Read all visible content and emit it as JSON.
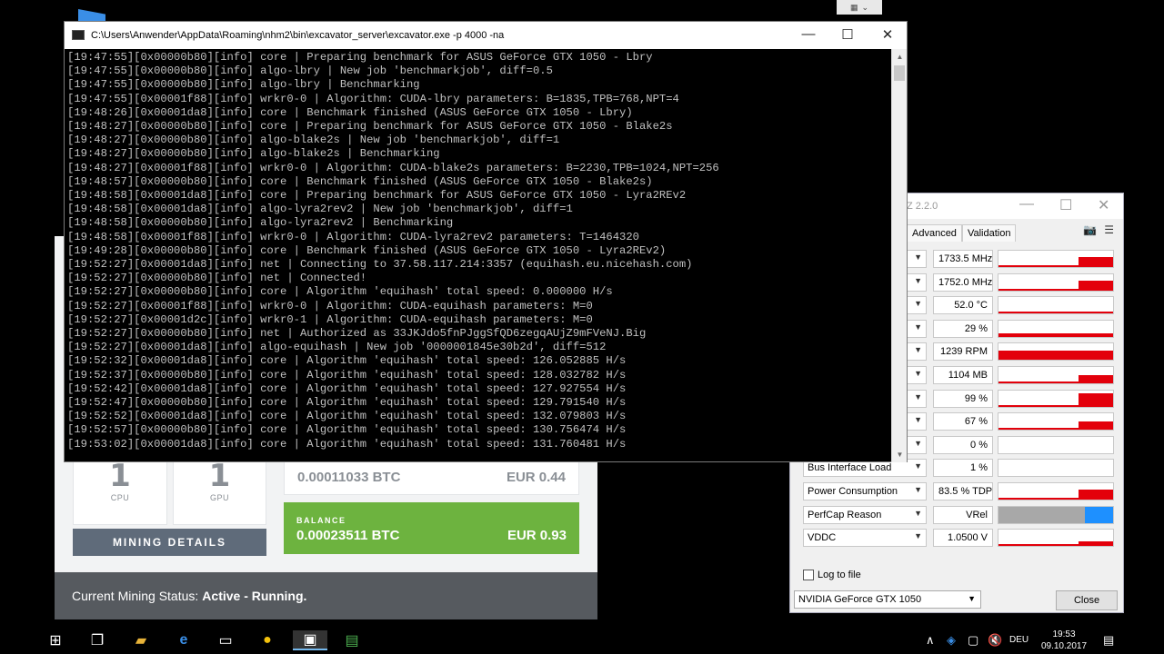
{
  "console": {
    "title": "C:\\Users\\Anwender\\AppData\\Roaming\\nhm2\\bin\\excavator_server\\excavator.exe  -p 4000 -na",
    "lines": [
      "[19:47:55][0x00000b80][info] core | Preparing benchmark for ASUS GeForce GTX 1050 - Lbry",
      "[19:47:55][0x00000b80][info] algo-lbry | New job 'benchmarkjob', diff=0.5",
      "[19:47:55][0x00000b80][info] algo-lbry | Benchmarking",
      "[19:47:55][0x00001f88][info] wrkr0-0 | Algorithm: CUDA-lbry parameters: B=1835,TPB=768,NPT=4",
      "[19:48:26][0x00001da8][info] core | Benchmark finished (ASUS GeForce GTX 1050 - Lbry)",
      "[19:48:27][0x00000b80][info] core | Preparing benchmark for ASUS GeForce GTX 1050 - Blake2s",
      "[19:48:27][0x00000b80][info] algo-blake2s | New job 'benchmarkjob', diff=1",
      "[19:48:27][0x00000b80][info] algo-blake2s | Benchmarking",
      "[19:48:27][0x00001f88][info] wrkr0-0 | Algorithm: CUDA-blake2s parameters: B=2230,TPB=1024,NPT=256",
      "[19:48:57][0x00000b80][info] core | Benchmark finished (ASUS GeForce GTX 1050 - Blake2s)",
      "[19:48:58][0x00001da8][info] core | Preparing benchmark for ASUS GeForce GTX 1050 - Lyra2REv2",
      "[19:48:58][0x00001da8][info] algo-lyra2rev2 | New job 'benchmarkjob', diff=1",
      "[19:48:58][0x00000b80][info] algo-lyra2rev2 | Benchmarking",
      "[19:48:58][0x00001f88][info] wrkr0-0 | Algorithm: CUDA-lyra2rev2 parameters: T=1464320",
      "[19:49:28][0x00000b80][info] core | Benchmark finished (ASUS GeForce GTX 1050 - Lyra2REv2)",
      "[19:52:27][0x00001da8][info] net | Connecting to 37.58.117.214:3357 (equihash.eu.nicehash.com)",
      "[19:52:27][0x00000b80][info] net | Connected!",
      "[19:52:27][0x00000b80][info] core | Algorithm 'equihash' total speed: 0.000000 H/s",
      "[19:52:27][0x00001f88][info] wrkr0-0 | Algorithm: CUDA-equihash parameters: M=0",
      "[19:52:27][0x00001d2c][info] wrkr0-1 | Algorithm: CUDA-equihash parameters: M=0",
      "[19:52:27][0x00000b80][info] net | Authorized as 33JKJdo5fnPJggSfQD6zegqAUjZ9mFVeNJ.Big",
      "[19:52:27][0x00001da8][info] algo-equihash | New job '0000001845e30b2d', diff=512",
      "[19:52:32][0x00001da8][info] core | Algorithm 'equihash' total speed: 126.052885 H/s",
      "[19:52:37][0x00000b80][info] core | Algorithm 'equihash' total speed: 128.032782 H/s",
      "[19:52:42][0x00001da8][info] core | Algorithm 'equihash' total speed: 127.927554 H/s",
      "[19:52:47][0x00000b80][info] core | Algorithm 'equihash' total speed: 129.791540 H/s",
      "[19:52:52][0x00001da8][info] core | Algorithm 'equihash' total speed: 132.079803 H/s",
      "[19:52:57][0x00000b80][info] core | Algorithm 'equihash' total speed: 130.756474 H/s",
      "[19:53:02][0x00001da8][info] core | Algorithm 'equihash' total speed: 131.760481 H/s"
    ],
    "minimize": "—",
    "maximize": "☐",
    "close": "✕"
  },
  "nicehash": {
    "cpu_count": "1",
    "cpu_label": "CPU",
    "gpu_count": "1",
    "gpu_label": "GPU",
    "details_button": "MINING DETAILS",
    "unpaid_btc": "0.00011033 BTC",
    "unpaid_eur": "EUR 0.44",
    "balance_label": "BALANCE",
    "balance_btc": "0.00023511 BTC",
    "balance_eur": "EUR 0.93",
    "status_prefix": "Current Mining Status:",
    "status_value": "Active - Running."
  },
  "gpuz": {
    "title": "Z 2.2.0",
    "tabs": [
      "Advanced",
      "Validation"
    ],
    "sensors": [
      {
        "name": "",
        "value": "1733.5 MHz",
        "fill": 0.3,
        "fill_h": 0.6
      },
      {
        "name": "",
        "value": "1752.0 MHz",
        "fill": 0.3,
        "fill_h": 0.6
      },
      {
        "name": "",
        "value": "52.0 °C",
        "fill": 1.0,
        "fill_h": 0.15
      },
      {
        "name": "",
        "value": "29 %",
        "fill": 1.0,
        "fill_h": 0.2
      },
      {
        "name": "",
        "value": "1239 RPM",
        "fill": 1.0,
        "fill_h": 0.6
      },
      {
        "name": "",
        "value": "1104 MB",
        "fill": 0.3,
        "fill_h": 0.5
      },
      {
        "name": "",
        "value": "99 %",
        "fill": 0.3,
        "fill_h": 0.8
      },
      {
        "name": "",
        "value": "67 %",
        "fill": 0.3,
        "fill_h": 0.5
      },
      {
        "name": "",
        "value": "0 %",
        "fill": 0.0,
        "fill_h": 0.0
      },
      {
        "name": "Bus Interface Load",
        "value": "1 %",
        "fill": 0.0,
        "fill_h": 0.0
      },
      {
        "name": "Power Consumption",
        "value": "83.5 % TDP",
        "fill": 0.3,
        "fill_h": 0.6
      },
      {
        "name": "PerfCap Reason",
        "value": "VRel",
        "fill": 1.0,
        "fill_h": 1.0,
        "perfcap": true
      },
      {
        "name": "VDDC",
        "value": "1.0500 V",
        "fill": 0.3,
        "fill_h": 0.3
      }
    ],
    "log_label": "Log to file",
    "card_name": "NVIDIA GeForce GTX 1050",
    "close_button": "Close",
    "colors": {
      "sensor": "#e3000b",
      "perfcap_grey": "#a8a8a8",
      "perfcap_blue": "#1e90ff"
    }
  },
  "taskbar": {
    "lang": "DEU",
    "time": "19:53",
    "date": "09.10.2017",
    "icons": [
      "windows-start-icon",
      "task-view-icon",
      "file-explorer-icon",
      "edge-browser-icon",
      "terminal-icon",
      "nicehash-icon",
      "gpuz-icon",
      "miner-icon"
    ]
  }
}
